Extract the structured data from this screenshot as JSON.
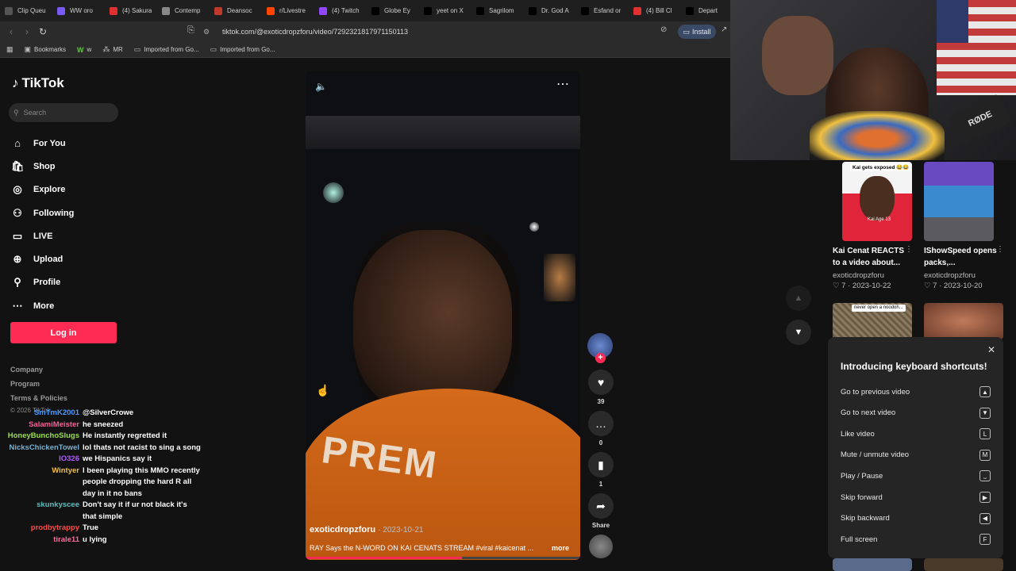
{
  "browser": {
    "tabs": [
      {
        "label": "Clip Queu",
        "icon_color": "#555"
      },
      {
        "label": "WW oro",
        "icon_color": "#7a5af5"
      },
      {
        "label": "(4) Sakura",
        "icon_color": "#e03030"
      },
      {
        "label": "Contemp",
        "icon_color": "#888"
      },
      {
        "label": "Deansoc",
        "icon_color": "#c0392b"
      },
      {
        "label": "r/Livestre",
        "icon_color": "#ff4500"
      },
      {
        "label": "(4) Twitch",
        "icon_color": "#9146ff"
      },
      {
        "label": "Globe Ey",
        "icon_color": "#000"
      },
      {
        "label": "yeet on X",
        "icon_color": "#000"
      },
      {
        "label": "Sagrilom",
        "icon_color": "#000"
      },
      {
        "label": "Dr. God A",
        "icon_color": "#000"
      },
      {
        "label": "Esfand or",
        "icon_color": "#000"
      },
      {
        "label": "(4) Bill Cl",
        "icon_color": "#e03030"
      },
      {
        "label": "Depart",
        "icon_color": "#000"
      }
    ],
    "url": "tiktok.com/@exoticdropzforu/video/7292321817971150113",
    "install_label": "Install",
    "bookmarks": [
      {
        "label": "Bookmarks",
        "icon": "bookmark-folder-icon"
      },
      {
        "label": "w",
        "icon": "w-icon"
      },
      {
        "label": "MR",
        "icon": "mr-icon"
      },
      {
        "label": "Imported from Go...",
        "icon": "folder-icon"
      },
      {
        "label": "Imported from Go...",
        "icon": "folder-icon"
      }
    ]
  },
  "sidebar": {
    "logo": "TikTok",
    "search_placeholder": "Search",
    "nav": [
      {
        "label": "For You",
        "icon": "home-icon"
      },
      {
        "label": "Shop",
        "icon": "shop-icon"
      },
      {
        "label": "Explore",
        "icon": "compass-icon"
      },
      {
        "label": "Following",
        "icon": "following-icon"
      },
      {
        "label": "LIVE",
        "icon": "live-icon"
      },
      {
        "label": "Upload",
        "icon": "upload-icon"
      },
      {
        "label": "Profile",
        "icon": "profile-icon"
      },
      {
        "label": "More",
        "icon": "more-icon"
      }
    ],
    "login_label": "Log in",
    "footer": [
      "Company",
      "Program",
      "Terms & Policies"
    ],
    "copyright": "© 2026 TikTok"
  },
  "chat": [
    {
      "name": "SmTmK2001",
      "color": "#4a9aff",
      "msg": "@SilverCrowe"
    },
    {
      "name": "SalamiMeister",
      "color": "#ff5a9a",
      "msg": "he sneezed"
    },
    {
      "name": "HoneyBunchoSlugs",
      "color": "#9ae04a",
      "msg": "He instantly regretted it"
    },
    {
      "name": "NicksChickenTowel",
      "color": "#7ab0d0",
      "msg": "lol thats not racist to sing a song"
    },
    {
      "name": "IO326",
      "color": "#b05aff",
      "msg": "we Hispanics say it"
    },
    {
      "name": "Wintyer",
      "color": "#f0c040",
      "msg": "I been playing this MMO recently people dropping the hard R all day in it no bans"
    },
    {
      "name": "skunkyscee",
      "color": "#5ac0c0",
      "msg": "Don't say it if ur not black it's that simple"
    },
    {
      "name": "prodbytrappy",
      "color": "#ff4a4a",
      "msg": "True"
    },
    {
      "name": "tirale11",
      "color": "#ff6a9a",
      "msg": "u lying"
    }
  ],
  "video": {
    "author": "exoticdropzforu",
    "date": "2023-10-21",
    "description": "RAY Says the N-WORD ON KAI CENATS STREAM #viral #kaicenat ...",
    "more_label": "more",
    "shirt_text": "PREM",
    "progress": 0.57,
    "likes": "39",
    "comments": "0",
    "saves": "1",
    "share_label": "Share"
  },
  "webcam": {
    "mic_label": "RØDE"
  },
  "related": [
    {
      "title": "Kai Cenat REACTS to a video about...",
      "author": "exoticdropzforu",
      "likes": "7",
      "date": "2023-10-22",
      "caption": "Kai gets exposed 😂😂",
      "thumb_label": "Kai Age 13"
    },
    {
      "title": "IShowSpeed opens packs,...",
      "author": "exoticdropzforu",
      "likes": "7",
      "date": "2023-10-20"
    },
    {
      "caption": "never open a noodoh..."
    }
  ],
  "shortcuts": {
    "title": "Introducing keyboard shortcuts!",
    "items": [
      {
        "label": "Go to previous video",
        "key": "▲"
      },
      {
        "label": "Go to next video",
        "key": "▼"
      },
      {
        "label": "Like video",
        "key": "L"
      },
      {
        "label": "Mute / unmute video",
        "key": "M"
      },
      {
        "label": "Play / Pause",
        "key": "⎵"
      },
      {
        "label": "Skip forward",
        "key": "▶"
      },
      {
        "label": "Skip backward",
        "key": "◀"
      },
      {
        "label": "Full screen",
        "key": "F"
      }
    ]
  }
}
